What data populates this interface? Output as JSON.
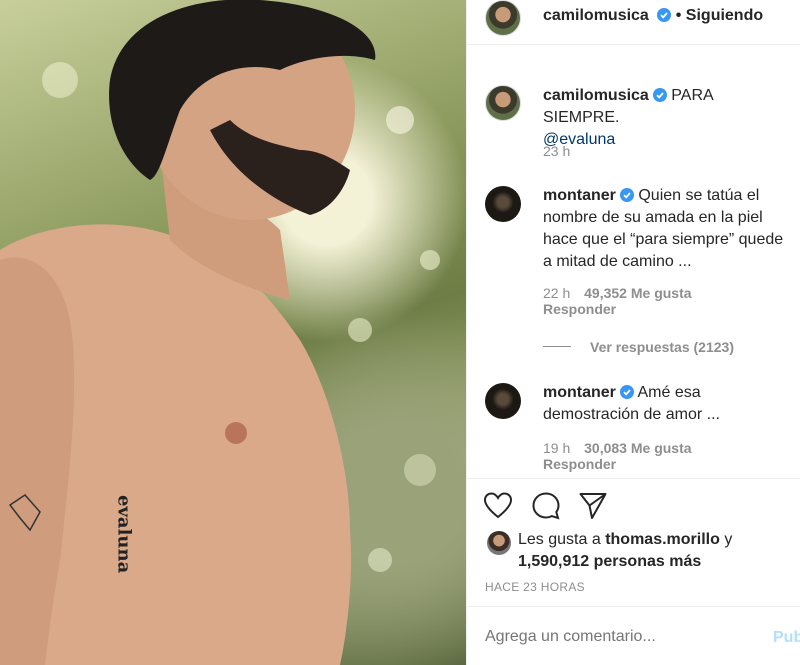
{
  "header": {
    "username": "camilomusica",
    "dot": "•",
    "follow_status": "Siguiendo"
  },
  "caption": {
    "username": "camilomusica",
    "text": "PARA SIEMPRE.",
    "mention": "@evaluna",
    "time": "23 h"
  },
  "comments": [
    {
      "username": "montaner",
      "text": "Quien se tatúa el nombre de su amada en la piel hace que el “para siempre” quede a mitad de camino ...",
      "time": "22 h",
      "likes": "49,352 Me gusta",
      "reply": "Responder"
    },
    {
      "username": "montaner",
      "text": "Amé esa demostración de amor ...",
      "time": "19 h",
      "likes": "30,083 Me gusta",
      "reply": "Responder"
    }
  ],
  "view_replies": "Ver respuestas (2123)",
  "likes": {
    "prefix": "Les gusta a",
    "user": "thomas.morillo",
    "conj": "y",
    "others": "1,590,912 personas más"
  },
  "timestamp": "HACE 23 HORAS",
  "comment_box": {
    "placeholder": "Agrega un comentario...",
    "publish": "Pub"
  },
  "colors": {
    "verified": "#3897f0",
    "link": "#00376b",
    "publish": "#b2dffc"
  }
}
